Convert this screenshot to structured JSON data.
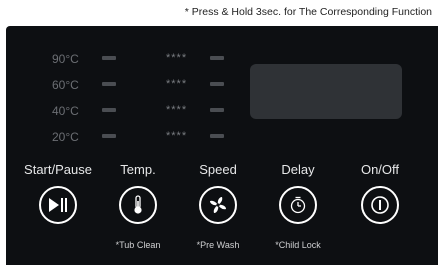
{
  "note": "* Press & Hold 3sec. for The Corresponding Function",
  "temperatures": [
    "90°C",
    "60°C",
    "40°C",
    "20°C"
  ],
  "stars": [
    "****",
    "****",
    "****",
    "****"
  ],
  "buttons": [
    {
      "title": "Start/Pause",
      "icon": "play-pause-icon",
      "sub": ""
    },
    {
      "title": "Temp.",
      "icon": "thermometer-icon",
      "sub": "*Tub Clean"
    },
    {
      "title": "Speed",
      "icon": "fan-icon",
      "sub": "*Pre Wash"
    },
    {
      "title": "Delay",
      "icon": "timer-icon",
      "sub": "*Child Lock"
    },
    {
      "title": "On/Off",
      "icon": "power-icon",
      "sub": ""
    }
  ],
  "colors": {
    "panel": "#0d0f12",
    "display": "#2f3236",
    "led_off": "#4a4d52"
  }
}
